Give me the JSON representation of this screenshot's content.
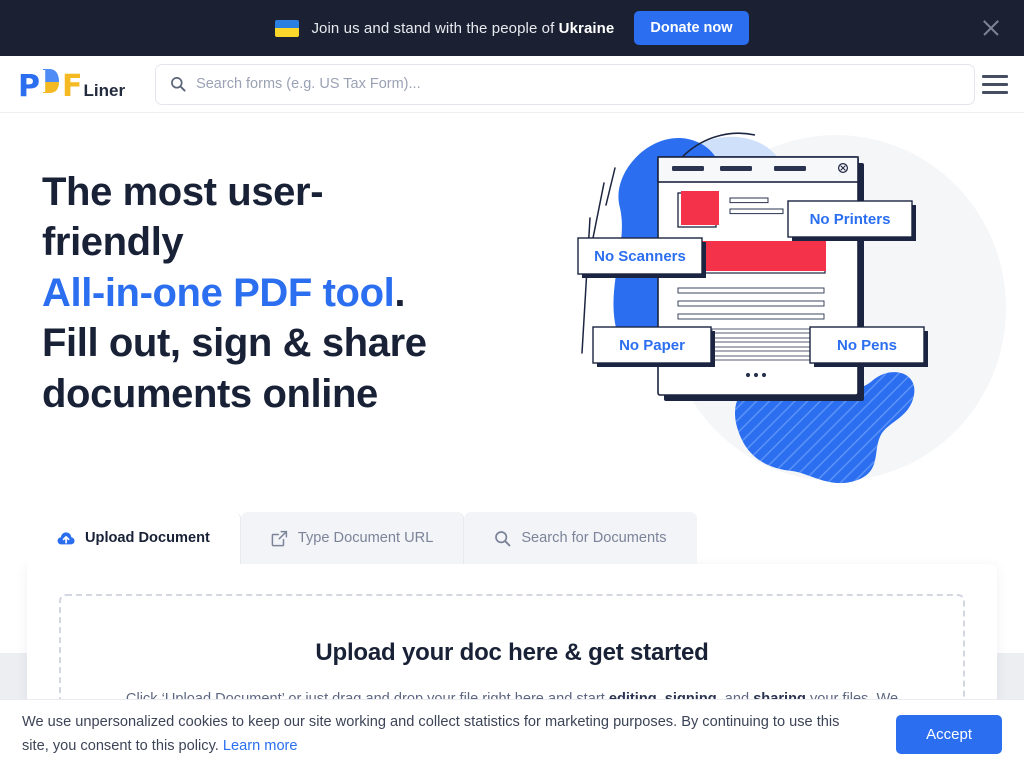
{
  "promo_banner": {
    "flag_icon": "ukraine-flag-icon",
    "text_before": "Join us and stand with the people of ",
    "text_bold": "Ukraine",
    "donate_label": "Donate now",
    "close_icon": "close-icon",
    "bg_color": "#1b2133",
    "accent_color": "#2b6ff0"
  },
  "header": {
    "logo": {
      "part1": "P",
      "part2": "D",
      "part3": "F",
      "wordmark": "Liner"
    },
    "search": {
      "placeholder": "Search forms (e.g. US Tax Form)...",
      "value": "",
      "icon": "search-icon"
    },
    "menu_icon": "hamburger-menu-icon"
  },
  "hero": {
    "line1": "The most user-",
    "line2": "friendly",
    "line3_accent": "All-in-one PDF tool",
    "line3_period": ".",
    "line4": "Fill out, sign & share",
    "line5": "documents online",
    "accent_color": "#2b6ff0",
    "illustration": {
      "labels": [
        "No Printers",
        "No Scanners",
        "No Paper",
        "No Pens"
      ],
      "label_color": "#2b6ff0",
      "accent_red": "#f4334b",
      "accent_blue": "#2b6ff0",
      "dark": "#1b2440"
    }
  },
  "tabs": [
    {
      "label": "Upload Document",
      "icon": "cloud-upload-icon",
      "active": true
    },
    {
      "label": "Type Document URL",
      "icon": "external-link-icon",
      "active": false
    },
    {
      "label": "Search for Documents",
      "icon": "search-icon",
      "active": false
    }
  ],
  "upload_panel": {
    "title": "Upload your doc here & get started",
    "subtitle_1": "Click ‘Upload Document’ or just drag and drop your file right here and start ",
    "subtitle_b1": "editing",
    "subtitle_2": ", ",
    "subtitle_b2": "signing",
    "subtitle_3": ", and ",
    "subtitle_b3": "sharing",
    "subtitle_4": " your files. We"
  },
  "cookie_bar": {
    "text_1": "We use unpersonalized cookies to keep our site working and collect statistics for marketing purposes. By continuing to use this site, you consent to this policy. ",
    "link_label": "Learn more",
    "accept_label": "Accept",
    "accent_color": "#2b6ff0"
  }
}
